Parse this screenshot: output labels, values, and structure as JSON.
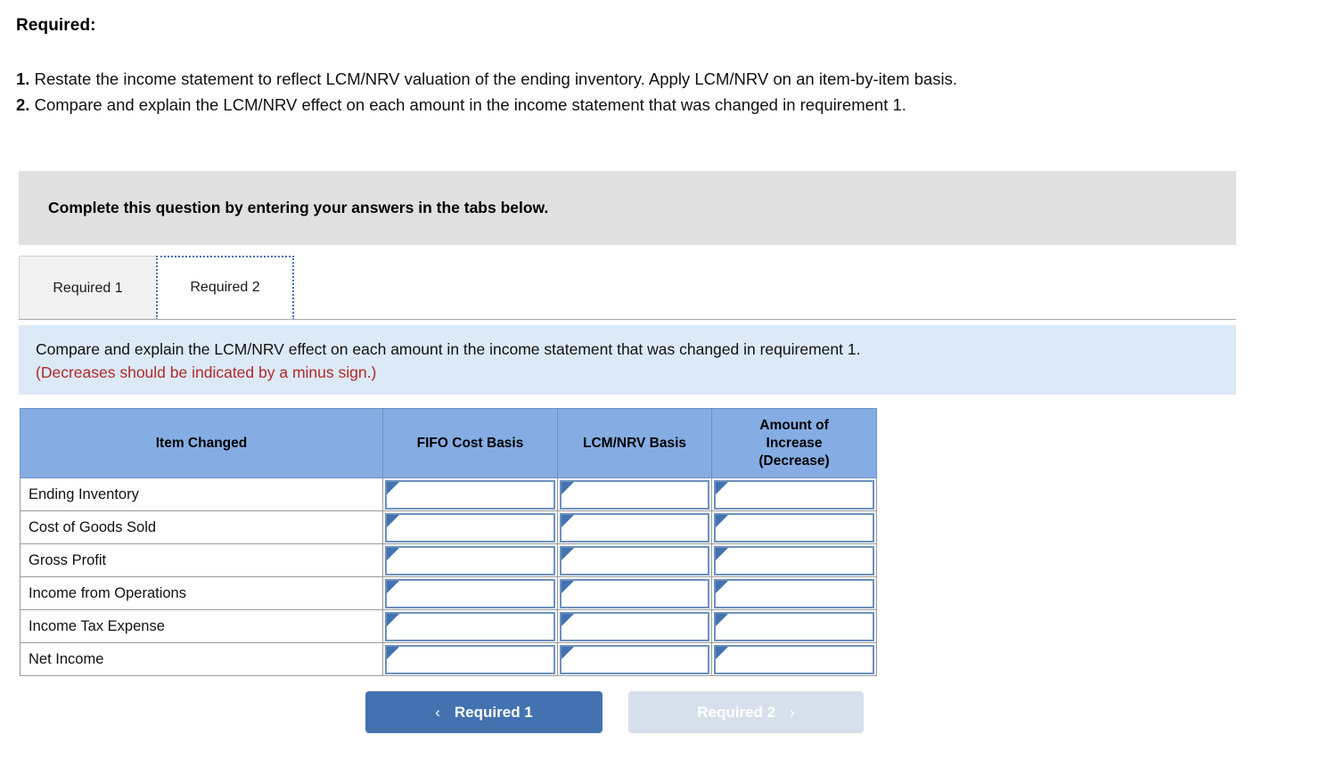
{
  "required": {
    "heading": "Required:",
    "items": [
      {
        "num": "1.",
        "text": "Restate the income statement to reflect LCM/NRV valuation of the ending inventory. Apply LCM/NRV on an item-by-item basis."
      },
      {
        "num": "2.",
        "text": "Compare and explain the LCM/NRV effect on each amount in the income statement that was changed in requirement 1."
      }
    ]
  },
  "banner": {
    "text": "Complete this question by entering your answers in the tabs below."
  },
  "tabs": [
    {
      "label": "Required 1",
      "active": false
    },
    {
      "label": "Required 2",
      "active": true
    }
  ],
  "info": {
    "line1": "Compare and explain the LCM/NRV effect on each amount in the income statement that was changed in requirement 1.",
    "line2": "(Decreases should be indicated by a minus sign.)"
  },
  "table": {
    "headers": [
      "Item Changed",
      "FIFO Cost Basis",
      "LCM/NRV Basis",
      "Amount of Increase (Decrease)"
    ],
    "header_amount_lines": [
      "Amount of",
      "Increase",
      "(Decrease)"
    ],
    "rows": [
      {
        "item": "Ending Inventory",
        "fifo": "",
        "lcm": "",
        "amount": ""
      },
      {
        "item": "Cost of Goods Sold",
        "fifo": "",
        "lcm": "",
        "amount": ""
      },
      {
        "item": "Gross Profit",
        "fifo": "",
        "lcm": "",
        "amount": ""
      },
      {
        "item": "Income from Operations",
        "fifo": "",
        "lcm": "",
        "amount": ""
      },
      {
        "item": "Income Tax Expense",
        "fifo": "",
        "lcm": "",
        "amount": ""
      },
      {
        "item": "Net Income",
        "fifo": "",
        "lcm": "",
        "amount": ""
      }
    ]
  },
  "nav": {
    "prev_label": "Required 1",
    "next_label": "Required 2",
    "prev_chevron": "‹",
    "next_chevron": "›"
  },
  "colors": {
    "header_blue": "#85ADE3",
    "banner_gray": "#E0E0E0",
    "info_blue": "#DCE9F7",
    "red_text": "#B02A2A",
    "button_blue": "#4472B0",
    "button_disabled": "#D6E0EC"
  }
}
